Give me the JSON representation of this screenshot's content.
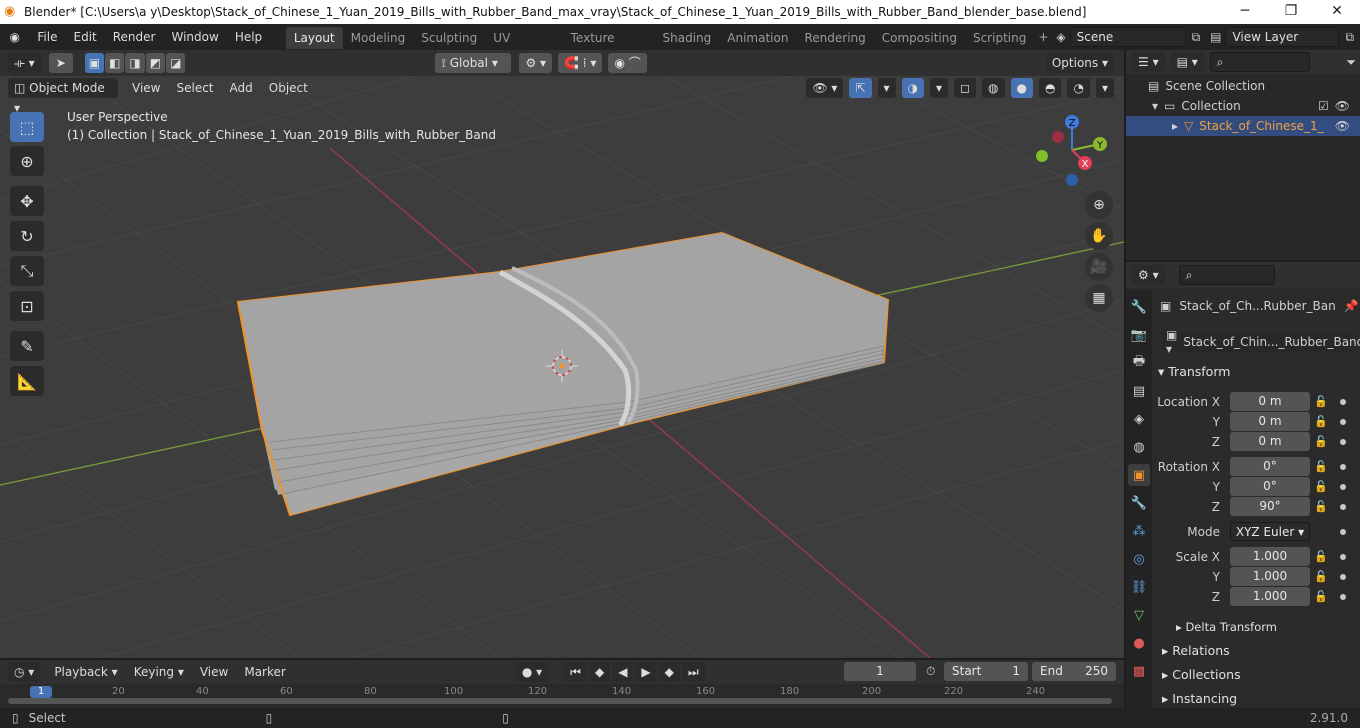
{
  "title": {
    "app": "Blender* [C:\\Users\\a y\\Desktop\\Stack_of_Chinese_1_Yuan_2019_Bills_with_Rubber_Band_max_vray\\Stack_of_Chinese_1_Yuan_2019_Bills_with_Rubber_Band_blender_base.blend]"
  },
  "menus": [
    "File",
    "Edit",
    "Render",
    "Window",
    "Help"
  ],
  "workspaces": [
    "Layout",
    "Modeling",
    "Sculpting",
    "UV Editing",
    "Texture Paint",
    "Shading",
    "Animation",
    "Rendering",
    "Compositing",
    "Scripting"
  ],
  "scene": "Scene",
  "view_layer": "View Layer",
  "header": {
    "transform": "Global",
    "options": "Options"
  },
  "viewport_header": {
    "mode": "Object Mode",
    "menus": [
      "View",
      "Select",
      "Add",
      "Object"
    ]
  },
  "viewport": {
    "perspective": "User Perspective",
    "collection_info": "(1) Collection | Stack_of_Chinese_1_Yuan_2019_Bills_with_Rubber_Band"
  },
  "gizmo": {
    "z": "Z",
    "y": "Y",
    "x": "X"
  },
  "outliner": {
    "scene_collection": "Scene Collection",
    "collection": "Collection",
    "object": "Stack_of_Chinese_1_"
  },
  "properties": {
    "object_name": "Stack_of_Ch...Rubber_Ban",
    "object_data": "Stack_of_Chin..._Rubber_Band",
    "transform": "Transform",
    "location": {
      "label_x": "Location X",
      "label_y": "Y",
      "label_z": "Z",
      "x": "0 m",
      "y": "0 m",
      "z": "0 m"
    },
    "rotation": {
      "label_x": "Rotation X",
      "label_y": "Y",
      "label_z": "Z",
      "x": "0°",
      "y": "0°",
      "z": "90°"
    },
    "mode_label": "Mode",
    "mode": "XYZ Euler",
    "scale": {
      "label_x": "Scale X",
      "label_y": "Y",
      "label_z": "Z",
      "x": "1.000",
      "y": "1.000",
      "z": "1.000"
    },
    "delta": "Delta Transform",
    "relations": "Relations",
    "collections": "Collections",
    "instancing": "Instancing"
  },
  "timeline": {
    "menus": [
      "Playback",
      "Keying",
      "View",
      "Marker"
    ],
    "current_frame": "1",
    "start_label": "Start",
    "start": "1",
    "end_label": "End",
    "end": "250",
    "ticks": [
      "1",
      "20",
      "40",
      "60",
      "80",
      "100",
      "120",
      "140",
      "160",
      "180",
      "200",
      "220",
      "240"
    ]
  },
  "status": {
    "left": "Select",
    "version": "2.91.0"
  },
  "colors": {
    "accent": "#4772b3",
    "selection": "#e87d0d",
    "x_axis": "#e23e55",
    "y_axis": "#8cba2e",
    "z_axis": "#3d7be0"
  }
}
